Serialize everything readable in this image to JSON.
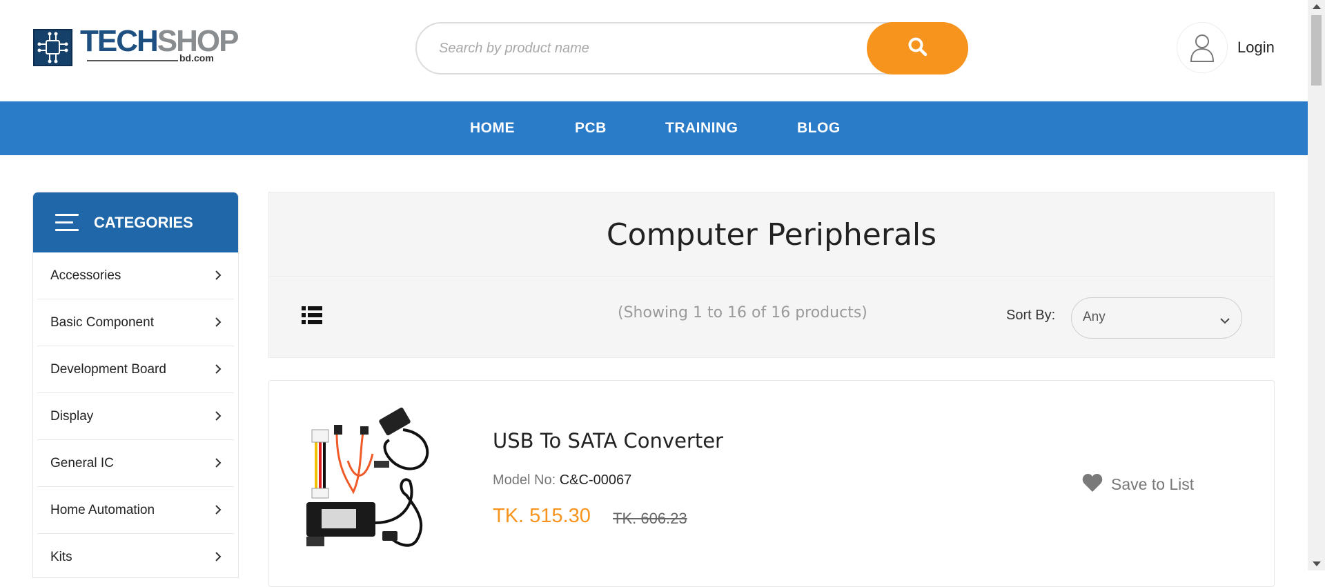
{
  "header": {
    "logo": {
      "text_primary": "TECH",
      "text_secondary": "SHOP",
      "domain": "bd.com"
    },
    "search": {
      "placeholder": "Search by product name",
      "button_icon": "search-icon"
    },
    "login": {
      "label": "Login",
      "icon": "user-icon"
    }
  },
  "nav": {
    "items": [
      {
        "label": "HOME"
      },
      {
        "label": "PCB"
      },
      {
        "label": "TRAINING"
      },
      {
        "label": "BLOG"
      }
    ]
  },
  "sidebar": {
    "title": "CATEGORIES",
    "items": [
      {
        "label": "Accessories"
      },
      {
        "label": "Basic Component"
      },
      {
        "label": "Development Board"
      },
      {
        "label": "Display"
      },
      {
        "label": "General IC"
      },
      {
        "label": "Home Automation"
      },
      {
        "label": "Kits"
      }
    ]
  },
  "main": {
    "page_title": "Computer Peripherals",
    "toolbar": {
      "count_text": "(Showing 1 to 16 of 16 products)",
      "sort_label": "Sort By:",
      "sort_value": "Any"
    },
    "products": [
      {
        "name": "USB To SATA Converter",
        "model_label": "Model No:",
        "model_value": "C&C-00067",
        "price": "TK. 515.30",
        "old_price": "TK. 606.23",
        "save_label": "Save to List"
      }
    ]
  },
  "colors": {
    "brand_blue": "#2a7bc8",
    "category_header": "#1f67a8",
    "accent_orange": "#f7941d"
  }
}
